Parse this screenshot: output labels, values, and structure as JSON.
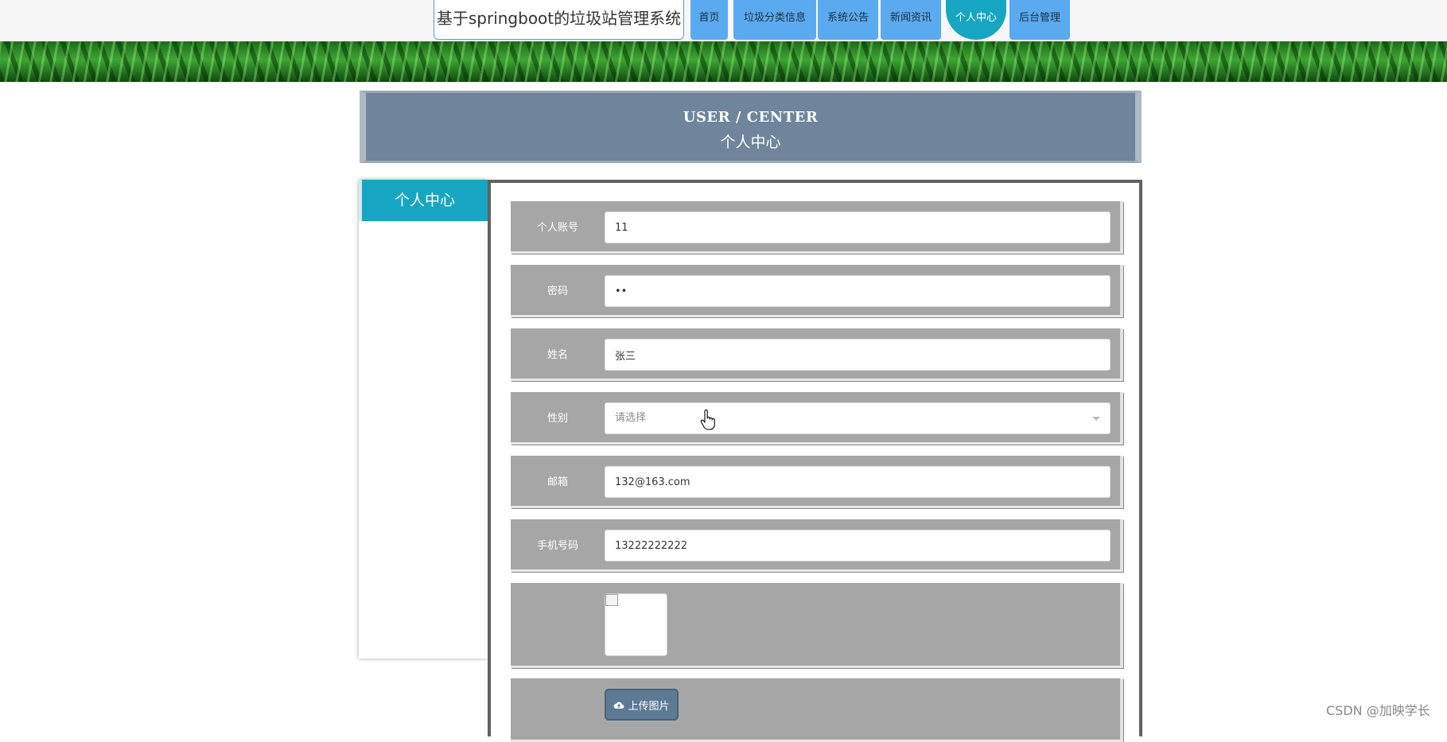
{
  "site": {
    "title": "基于springboot的垃圾站管理系统"
  },
  "nav": {
    "items": [
      {
        "label": "首页"
      },
      {
        "label": "垃圾分类信息"
      },
      {
        "label": "系统公告"
      },
      {
        "label": "新闻资讯"
      },
      {
        "label": "个人中心",
        "active": true
      },
      {
        "label": "后台管理"
      }
    ]
  },
  "page_header": {
    "title_en": "USER / CENTER",
    "title_cn": "个人中心"
  },
  "sidebar": {
    "items": [
      {
        "label": "个人中心",
        "active": true
      }
    ]
  },
  "form": {
    "account": {
      "label": "个人账号",
      "value": "11"
    },
    "password": {
      "label": "密码",
      "value": "••"
    },
    "name": {
      "label": "姓名",
      "value": "张三"
    },
    "gender": {
      "label": "性别",
      "placeholder": "请选择"
    },
    "email": {
      "label": "邮箱",
      "value": "132@163.com"
    },
    "phone": {
      "label": "手机号码",
      "value": "13222222222"
    },
    "upload_button": "上传图片"
  },
  "watermark": "CSDN @加映学长",
  "colors": {
    "nav_bg": "#5aaaf0",
    "nav_active": "#17a6c1",
    "header_bg": "#6e859c",
    "row_bg": "#a6a6a6",
    "upload_bg": "#5d7a95"
  },
  "icons": {
    "upload": "cloud-upload-icon",
    "cursor": "hand-pointer-icon",
    "select": "chevron-down-icon"
  }
}
